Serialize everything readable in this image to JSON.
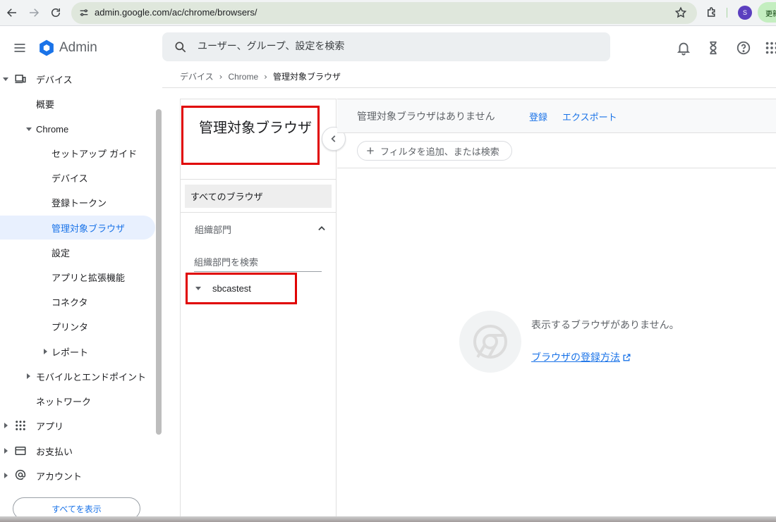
{
  "browser": {
    "url": "admin.google.com/ac/chrome/browsers/",
    "avatar_letter": "S",
    "update_label": "更新"
  },
  "header": {
    "app_name": "Admin",
    "search_placeholder": "ユーザー、グループ、設定を検索"
  },
  "sidebar": {
    "devices": "デバイス",
    "overview": "概要",
    "chrome": "Chrome",
    "chrome_items": [
      "セットアップ ガイド",
      "デバイス",
      "登録トークン",
      "管理対象ブラウザ",
      "設定",
      "アプリと拡張機能",
      "コネクタ",
      "プリンタ"
    ],
    "reports": "レポート",
    "mobile": "モバイルとエンドポイント",
    "network": "ネットワーク",
    "apps": "アプリ",
    "billing": "お支払い",
    "account": "アカウント",
    "show_all": "すべてを表示"
  },
  "breadcrumb": [
    "デバイス",
    "Chrome",
    "管理対象ブラウザ"
  ],
  "left_panel": {
    "title": "管理対象ブラウザ",
    "all_browsers": "すべてのブラウザ",
    "org_units_label": "組織部門",
    "ou_search_placeholder": "組織部門を検索",
    "ou_root": "sbcastest"
  },
  "main": {
    "no_browsers": "管理対象ブラウザはありません",
    "register": "登録",
    "export": "エクスポート",
    "filter_placeholder": "フィルタを追加、または検索",
    "empty_message": "表示するブラウザがありません。",
    "empty_link": "ブラウザの登録方法"
  },
  "colors": {
    "accent": "#1a73e8",
    "highlight_box": "#e00000",
    "active_bg": "#e8f0fe"
  }
}
